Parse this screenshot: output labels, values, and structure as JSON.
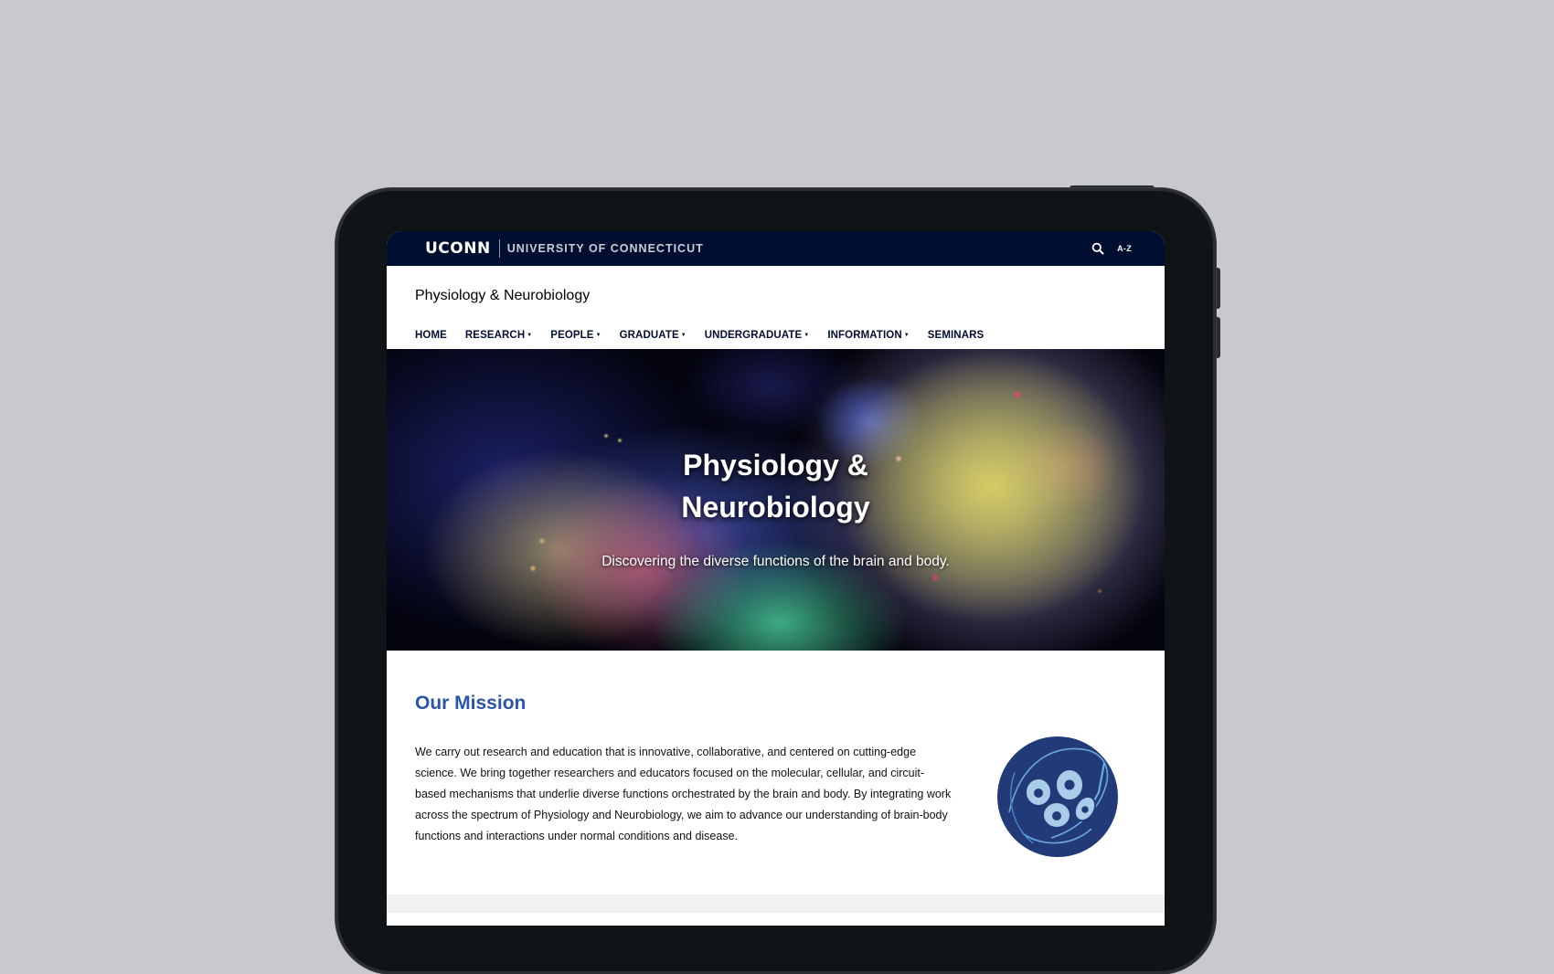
{
  "topbar": {
    "logo": "UCONN",
    "university": "UNIVERSITY OF CONNECTICUT",
    "search_icon": "search-icon",
    "az_label": "A-Z"
  },
  "site": {
    "title": "Physiology & Neurobiology"
  },
  "nav": {
    "items": [
      {
        "label": "HOME",
        "dropdown": false
      },
      {
        "label": "RESEARCH",
        "dropdown": true
      },
      {
        "label": "PEOPLE",
        "dropdown": true
      },
      {
        "label": "GRADUATE",
        "dropdown": true
      },
      {
        "label": "UNDERGRADUATE",
        "dropdown": true
      },
      {
        "label": "INFORMATION",
        "dropdown": true
      },
      {
        "label": "SEMINARS",
        "dropdown": false
      }
    ]
  },
  "hero": {
    "title_line1": "Physiology &",
    "title_line2": "Neurobiology",
    "subtitle": "Discovering the diverse functions of the brain and body."
  },
  "mission": {
    "title": "Our Mission",
    "text": "We carry out research and education that is innovative, collaborative, and centered on cutting-edge science.  We bring together researchers and educators focused on the molecular, cellular, and circuit-based mechanisms that underlie diverse functions orchestrated by the brain and body. By integrating work across the spectrum of Physiology and Neurobiology, we aim to advance our understanding of brain-body functions and interactions under normal conditions and disease.",
    "emblem_icon": "cells-icon"
  },
  "colors": {
    "page_bg": "#c9c9cd",
    "topbar_bg": "#000e2f",
    "accent_blue": "#2a55ad",
    "emblem_bg": "#233a78",
    "emblem_cell": "#a9cde8"
  }
}
